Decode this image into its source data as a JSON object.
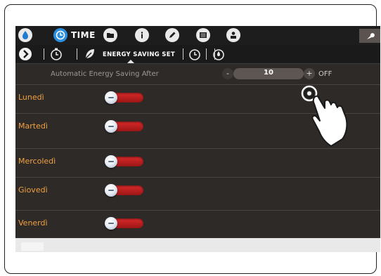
{
  "toolbar": {
    "tab_label": "TIME",
    "icons": [
      "water-drop-icon",
      "clock-icon",
      "folder-icon",
      "info-icon",
      "pencil-icon",
      "keyboard-icon",
      "user-lock-icon",
      "wrench-icon"
    ]
  },
  "subtoolbar": {
    "section_label": "ENERGY SAVING SET"
  },
  "setting": {
    "label": "Automatic Energy Saving After",
    "minus": "-",
    "value": "10",
    "plus": "+",
    "unit": "OFF"
  },
  "days": [
    {
      "label": "Lunedì"
    },
    {
      "label": "Martedì"
    },
    {
      "label": "Mercoledì"
    },
    {
      "label": "Giovedì"
    },
    {
      "label": "Venerdì"
    }
  ],
  "colors": {
    "day_label": "#f0a040",
    "toggle_off": "#c62020",
    "accent_blue": "#2b8fe0"
  }
}
